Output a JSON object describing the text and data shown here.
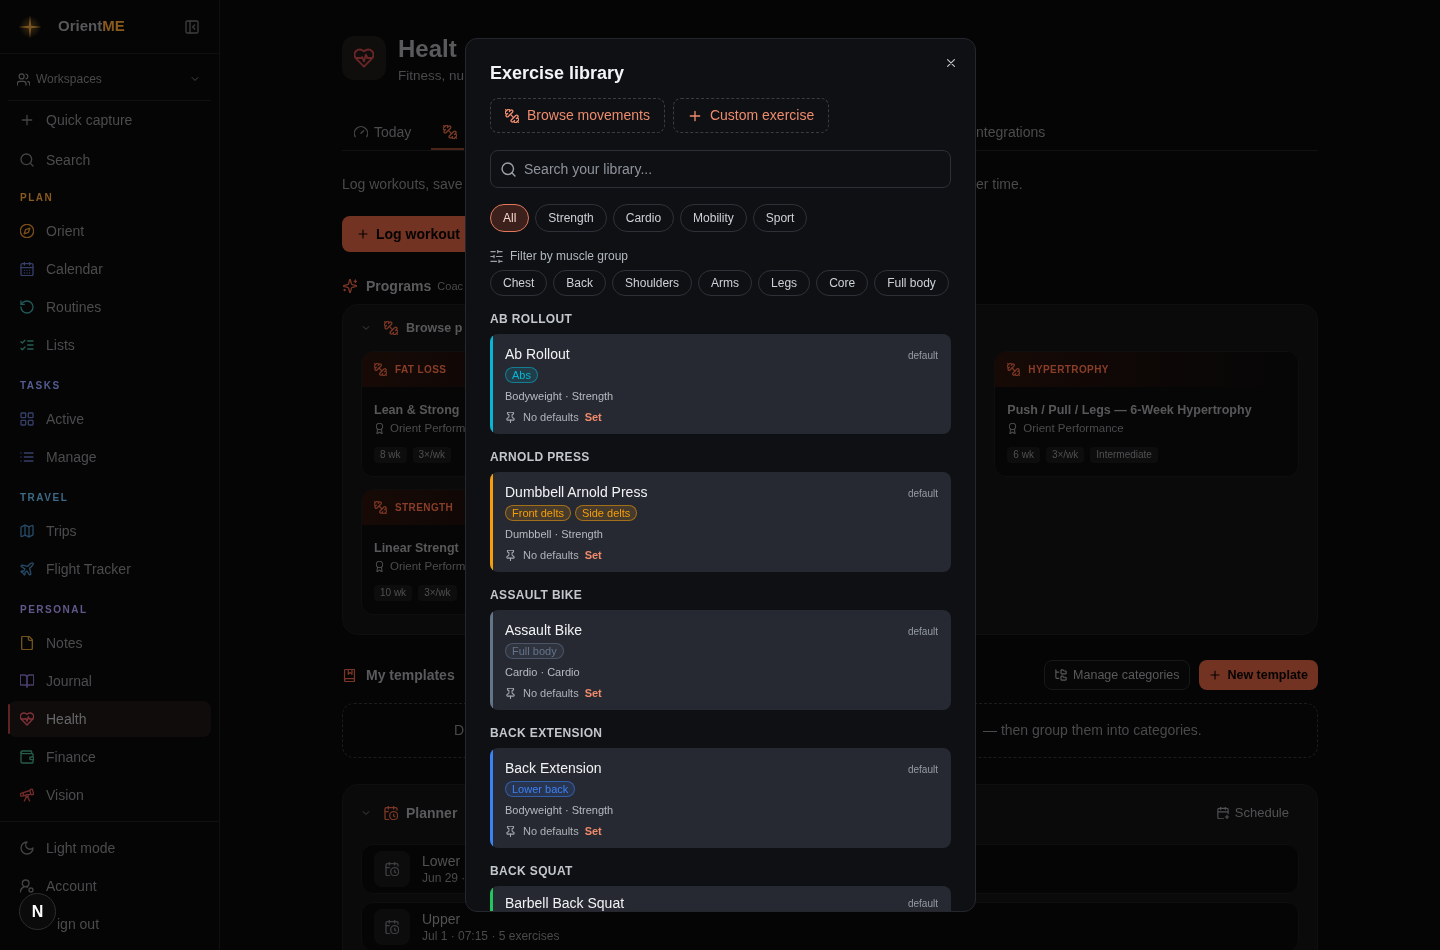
{
  "sidebar": {
    "brand": {
      "name": "Orient",
      "accent": "ME"
    },
    "workspaces": {
      "label": "Workspaces"
    },
    "actions": [
      {
        "label": "Quick capture"
      },
      {
        "label": "Search"
      }
    ],
    "sections": [
      {
        "title": "PLAN",
        "items": [
          {
            "label": "Orient",
            "selected": false
          },
          {
            "label": "Calendar",
            "selected": false
          },
          {
            "label": "Routines",
            "selected": false
          },
          {
            "label": "Lists",
            "selected": false
          }
        ]
      },
      {
        "title": "TASKS",
        "items": [
          {
            "label": "Active",
            "selected": false
          },
          {
            "label": "Manage",
            "selected": false
          }
        ]
      },
      {
        "title": "TRAVEL",
        "items": [
          {
            "label": "Trips",
            "selected": false
          },
          {
            "label": "Flight Tracker",
            "selected": false
          }
        ]
      },
      {
        "title": "PERSONAL",
        "items": [
          {
            "label": "Notes",
            "selected": false
          },
          {
            "label": "Journal",
            "selected": false
          },
          {
            "label": "Health",
            "selected": true
          },
          {
            "label": "Finance",
            "selected": false
          },
          {
            "label": "Vision",
            "selected": false
          }
        ]
      }
    ],
    "footer": [
      {
        "label": "Light mode"
      },
      {
        "label": "Account"
      },
      {
        "label": "ign out"
      }
    ]
  },
  "dev_badge": {
    "label": "N"
  },
  "header": {
    "title": "Healt",
    "subtitle": "Fitness, nu"
  },
  "tabs": [
    {
      "label": "Today",
      "selected": false
    },
    {
      "selected": true
    },
    {
      "label": "ntegrations",
      "selected": false
    }
  ],
  "intro": {
    "left": "Log workouts, save",
    "right": "er time."
  },
  "log_button": {
    "label": "Log workout"
  },
  "programs": {
    "title": "Programs",
    "caption": "Coac",
    "browse": {
      "label": "Browse p",
      "expanded": true
    },
    "cards": [
      {
        "category": "FAT LOSS",
        "title": "Lean & Strong",
        "author": "Orient Perform",
        "chips": [
          "8 wk",
          "3×/wk"
        ]
      },
      {
        "category": "HYPERTROPHY",
        "title": "Push / Pull / Legs — 6-Week Hypertrophy",
        "author": "Orient Performance",
        "chips": [
          "6 wk",
          "3×/wk",
          "Intermediate"
        ]
      },
      {
        "category": "STRENGTH",
        "title": "Linear Strengt",
        "author": "Orient Perform",
        "chips": [
          "10 wk",
          "3×/wk"
        ]
      }
    ]
  },
  "templates": {
    "title": "My templates",
    "buttons": [
      {
        "label": "Manage categories"
      },
      {
        "label": "New template"
      }
    ],
    "empty_text": {
      "left": "D",
      "right": "— then group them into categories."
    }
  },
  "planner": {
    "title": "Planner",
    "expanded": true,
    "schedule_button": "Schedule",
    "rows": [
      {
        "title": "Lower",
        "meta": "Jun 29 ·"
      },
      {
        "title": "Upper",
        "meta": "Jul 1 · 07:15 · 5 exercises"
      }
    ]
  },
  "modal": {
    "title": "Exercise library",
    "actions": [
      {
        "label": "Browse movements"
      },
      {
        "label": "Custom exercise"
      }
    ],
    "search": {
      "placeholder": "Search your library..."
    },
    "types": [
      {
        "label": "All",
        "selected": true
      },
      {
        "label": "Strength",
        "selected": false
      },
      {
        "label": "Cardio",
        "selected": false
      },
      {
        "label": "Mobility",
        "selected": false
      },
      {
        "label": "Sport",
        "selected": false
      }
    ],
    "muscle_filter": {
      "label": "Filter by muscle group",
      "chips": [
        {
          "label": "Chest",
          "selected": false
        },
        {
          "label": "Back",
          "selected": false
        },
        {
          "label": "Shoulders",
          "selected": false
        },
        {
          "label": "Arms",
          "selected": false
        },
        {
          "label": "Legs",
          "selected": false
        },
        {
          "label": "Core",
          "selected": false
        },
        {
          "label": "Full body",
          "selected": false
        }
      ]
    },
    "groups": [
      {
        "heading": "AB ROLLOUT",
        "exercises": [
          {
            "name": "Ab Rollout",
            "badge": "default",
            "color": "#06b6d4",
            "tags": [
              "Abs"
            ],
            "meta": "Bodyweight · Strength",
            "defaults": "No defaults",
            "action": "Set"
          }
        ]
      },
      {
        "heading": "ARNOLD PRESS",
        "exercises": [
          {
            "name": "Dumbbell Arnold Press",
            "badge": "default",
            "color": "#f59e0b",
            "tags": [
              "Front delts",
              "Side delts"
            ],
            "meta": "Dumbbell · Strength",
            "defaults": "No defaults",
            "action": "Set"
          }
        ]
      },
      {
        "heading": "ASSAULT BIKE",
        "exercises": [
          {
            "name": "Assault Bike",
            "badge": "default",
            "color": "#64748b",
            "tags": [
              "Full body"
            ],
            "meta": "Cardio · Cardio",
            "defaults": "No defaults",
            "action": "Set"
          }
        ]
      },
      {
        "heading": "BACK EXTENSION",
        "exercises": [
          {
            "name": "Back Extension",
            "badge": "default",
            "color": "#3b82f6",
            "tags": [
              "Lower back"
            ],
            "meta": "Bodyweight · Strength",
            "defaults": "No defaults",
            "action": "Set"
          }
        ]
      },
      {
        "heading": "BACK SQUAT",
        "exercises": [
          {
            "name": "Barbell Back Squat",
            "badge": "default",
            "color": "#22c55e"
          }
        ]
      }
    ]
  }
}
